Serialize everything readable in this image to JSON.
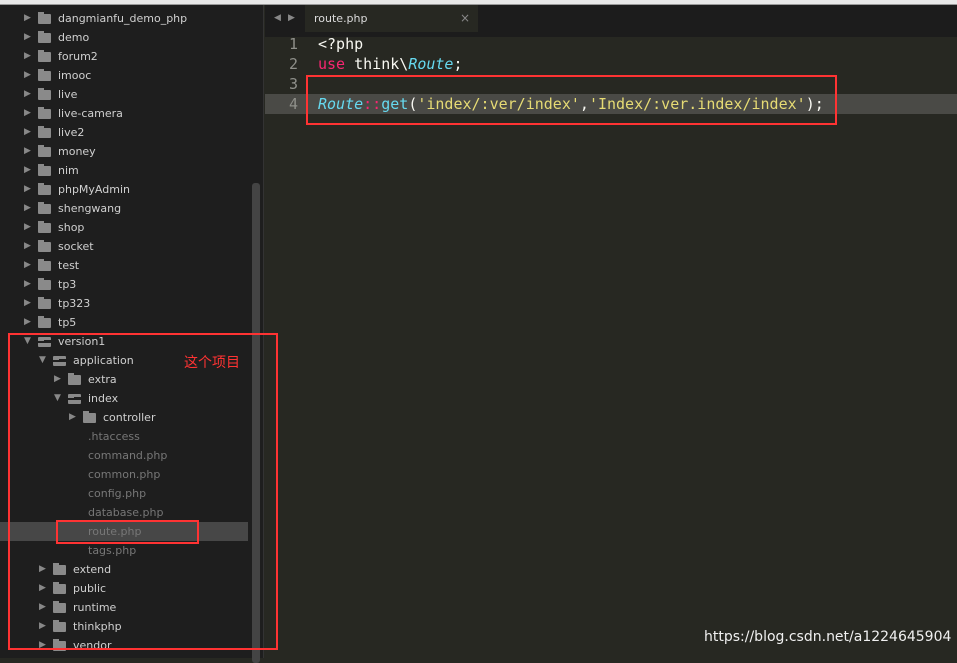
{
  "tab": {
    "title": "route.php",
    "close": "×"
  },
  "tree": [
    {
      "label": "dangmianfu_demo_php",
      "level": 0,
      "type": "folder"
    },
    {
      "label": "demo",
      "level": 0,
      "type": "folder"
    },
    {
      "label": "forum2",
      "level": 0,
      "type": "folder"
    },
    {
      "label": "imooc",
      "level": 0,
      "type": "folder"
    },
    {
      "label": "live",
      "level": 0,
      "type": "folder"
    },
    {
      "label": "live-camera",
      "level": 0,
      "type": "folder"
    },
    {
      "label": "live2",
      "level": 0,
      "type": "folder"
    },
    {
      "label": "money",
      "level": 0,
      "type": "folder"
    },
    {
      "label": "nim",
      "level": 0,
      "type": "folder"
    },
    {
      "label": "phpMyAdmin",
      "level": 0,
      "type": "folder"
    },
    {
      "label": "shengwang",
      "level": 0,
      "type": "folder"
    },
    {
      "label": "shop",
      "level": 0,
      "type": "folder"
    },
    {
      "label": "socket",
      "level": 0,
      "type": "folder"
    },
    {
      "label": "test",
      "level": 0,
      "type": "folder"
    },
    {
      "label": "tp3",
      "level": 0,
      "type": "folder"
    },
    {
      "label": "tp323",
      "level": 0,
      "type": "folder"
    },
    {
      "label": "tp5",
      "level": 0,
      "type": "folder"
    },
    {
      "label": "version1",
      "level": 0,
      "type": "open"
    },
    {
      "label": "application",
      "level": 1,
      "type": "open"
    },
    {
      "label": "extra",
      "level": 2,
      "type": "folder"
    },
    {
      "label": "index",
      "level": 2,
      "type": "open"
    },
    {
      "label": "controller",
      "level": 3,
      "type": "folder"
    },
    {
      "label": ".htaccess",
      "level": 3,
      "type": "file"
    },
    {
      "label": "command.php",
      "level": 3,
      "type": "file"
    },
    {
      "label": "common.php",
      "level": 3,
      "type": "file"
    },
    {
      "label": "config.php",
      "level": 3,
      "type": "file"
    },
    {
      "label": "database.php",
      "level": 3,
      "type": "file"
    },
    {
      "label": "route.php",
      "level": 3,
      "type": "file",
      "selected": true
    },
    {
      "label": "tags.php",
      "level": 3,
      "type": "file"
    },
    {
      "label": "extend",
      "level": 1,
      "type": "folder"
    },
    {
      "label": "public",
      "level": 1,
      "type": "folder"
    },
    {
      "label": "runtime",
      "level": 1,
      "type": "folder"
    },
    {
      "label": "thinkphp",
      "level": 1,
      "type": "folder"
    },
    {
      "label": "vendor",
      "level": 1,
      "type": "folder"
    }
  ],
  "code": {
    "line_numbers": [
      "1",
      "2",
      "3",
      "4"
    ],
    "l1": "<?php",
    "l2": {
      "kw": "use",
      "ns": " think\\",
      "cls": "Route",
      "end": ";"
    },
    "l4": {
      "cls": "Route",
      "op": "::",
      "fn": "get",
      "p1": "(",
      "s1": "'index/:ver/index'",
      "comma": ",",
      "s2": "'Index/:ver.index/index'",
      "p2": ");"
    }
  },
  "annotation": "这个项目",
  "watermark": "https://blog.csdn.net/a1224645904",
  "colors": {
    "highlight_box": "#ff3333",
    "keyword": "#f92672",
    "type": "#66d9ef",
    "string": "#e6db74"
  }
}
